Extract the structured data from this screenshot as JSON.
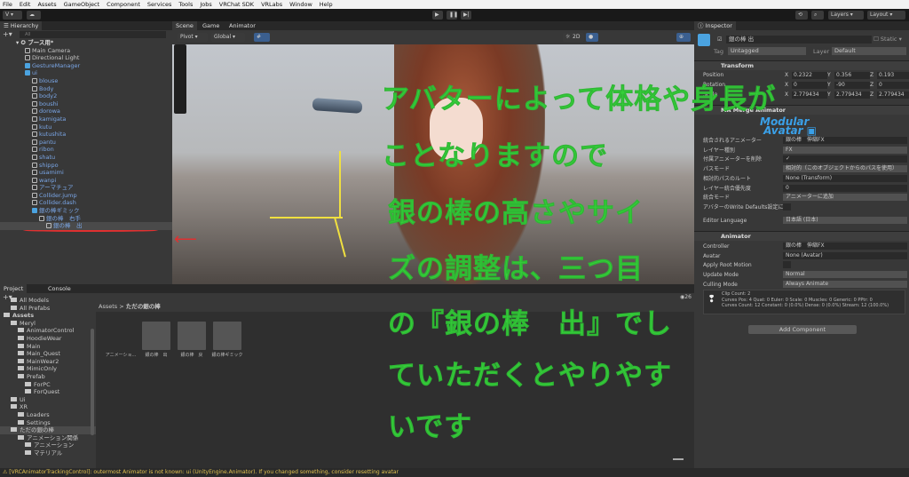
{
  "menu": [
    "File",
    "Edit",
    "Assets",
    "GameObject",
    "Component",
    "Services",
    "Tools",
    "Jobs",
    "VRChat SDK",
    "VRLabs",
    "Window",
    "Help"
  ],
  "toolbar": {
    "account": "V ▾",
    "layers": "Layers",
    "layout": "Layout"
  },
  "hierarchy": {
    "title": "Hierarchy",
    "search_placeholder": "All",
    "scene": "ブース用*",
    "items": [
      {
        "label": "Main Camera",
        "depth": 1,
        "blue": false
      },
      {
        "label": "Directional Light",
        "depth": 1,
        "blue": false
      },
      {
        "label": "GestureManager",
        "depth": 1,
        "blue": true
      },
      {
        "label": "ui",
        "depth": 1,
        "blue": true
      },
      {
        "label": "blouse",
        "depth": 2,
        "blue": true
      },
      {
        "label": "Body",
        "depth": 2,
        "blue": true
      },
      {
        "label": "body2",
        "depth": 2,
        "blue": true
      },
      {
        "label": "boushi",
        "depth": 2,
        "blue": true
      },
      {
        "label": "dorowa",
        "depth": 2,
        "blue": true
      },
      {
        "label": "kamigata",
        "depth": 2,
        "blue": true
      },
      {
        "label": "kutu",
        "depth": 2,
        "blue": true
      },
      {
        "label": "kutushita",
        "depth": 2,
        "blue": true
      },
      {
        "label": "pantu",
        "depth": 2,
        "blue": true
      },
      {
        "label": "ribon",
        "depth": 2,
        "blue": true
      },
      {
        "label": "shatu",
        "depth": 2,
        "blue": true
      },
      {
        "label": "shippo",
        "depth": 2,
        "blue": true
      },
      {
        "label": "usamimi",
        "depth": 2,
        "blue": true
      },
      {
        "label": "wanpi",
        "depth": 2,
        "blue": true
      },
      {
        "label": "アーマチュア",
        "depth": 2,
        "blue": true
      },
      {
        "label": "Collider.jump",
        "depth": 2,
        "blue": true
      },
      {
        "label": "Collider.dash",
        "depth": 2,
        "blue": true
      },
      {
        "label": "銀の棒ギミック",
        "depth": 2,
        "blue": true
      },
      {
        "label": "銀の棒　右手",
        "depth": 3,
        "blue": true
      },
      {
        "label": "銀の棒　出",
        "depth": 4,
        "blue": true
      }
    ]
  },
  "scene": {
    "tabs": [
      "Scene",
      "Game",
      "Animator"
    ],
    "pivot": "Pivot",
    "global": "Global",
    "mode2d": "2D"
  },
  "overlay_text": [
    "アバターによって体格や身長が",
    "ことなりますので",
    "銀の棒の高さやサイ",
    "ズの調整は、三つ目",
    "の『銀の棒　出』でし",
    "ていただくとやりやす",
    "いです"
  ],
  "inspector": {
    "title": "Inspector",
    "object_name": "銀の棒 出",
    "static": "Static",
    "tag_label": "Tag",
    "tag": "Untagged",
    "layer_label": "Layer",
    "layer": "Default",
    "transform": {
      "title": "Transform",
      "rows": [
        {
          "label": "Position",
          "x": "0.2322",
          "y": "0.356",
          "z": "0.193"
        },
        {
          "label": "Rotation",
          "x": "0",
          "y": "-90",
          "z": "0"
        },
        {
          "label": "Scale",
          "x": "2.779434",
          "y": "2.779434",
          "z": "2.779434"
        }
      ]
    },
    "merge": {
      "title": "MA Merge Animator",
      "logo": "Modular Avatar",
      "rows": [
        {
          "label": "統合されるアニメーター",
          "value": "銀の棒　伸縮FX"
        },
        {
          "label": "レイヤー種別",
          "value": "FX"
        },
        {
          "label": "付属アニメーターを削除",
          "value": "✓"
        },
        {
          "label": "パスモード",
          "value": "相対的（このオブジェクトからのパスを使用）"
        },
        {
          "label": "相対的パスのルート",
          "value": "None (Transform)"
        },
        {
          "label": "レイヤー統合優先度",
          "value": "0"
        },
        {
          "label": "統合モード",
          "value": "アニメーターに追加"
        },
        {
          "label": "アバターのWrite Defaults設定に",
          "value": ""
        }
      ],
      "lang_label": "Editor Language",
      "lang": "日本語 (日本)"
    },
    "animator": {
      "title": "Animator",
      "rows": [
        {
          "label": "Controller",
          "value": "銀の棒　伸縮FX"
        },
        {
          "label": "Avatar",
          "value": "None (Avatar)"
        },
        {
          "label": "Apply Root Motion",
          "value": ""
        },
        {
          "label": "Update Mode",
          "value": "Normal"
        },
        {
          "label": "Culling Mode",
          "value": "Always Animate"
        }
      ],
      "info": [
        "Clip Count: 2",
        "Curves Pos: 4 Quat: 0 Euler: 0 Scale: 0 Muscles: 0 Generic: 0 PPtr: 0",
        "Curves Count: 12 Constant: 0 (0.0%) Dense: 0 (0.0%) Stream: 12 (100.0%)"
      ]
    },
    "add_component": "Add Component"
  },
  "project": {
    "tabs": [
      "Project",
      "Console"
    ],
    "badge": "26",
    "breadcrumb": [
      "Assets",
      "ただの銀の棒"
    ],
    "tree": [
      {
        "label": "All Models",
        "depth": 1
      },
      {
        "label": "All Prefabs",
        "depth": 1
      },
      {
        "label": "Assets",
        "depth": 0
      },
      {
        "label": "Meryl",
        "depth": 1
      },
      {
        "label": "AnimatorControl",
        "depth": 2
      },
      {
        "label": "HoodieWear",
        "depth": 2
      },
      {
        "label": "Main",
        "depth": 2
      },
      {
        "label": "Main_Quest",
        "depth": 2
      },
      {
        "label": "MainWear2",
        "depth": 2
      },
      {
        "label": "MimicOnly",
        "depth": 2
      },
      {
        "label": "Prefab",
        "depth": 2
      },
      {
        "label": "ForPC",
        "depth": 3
      },
      {
        "label": "ForQuest",
        "depth": 3
      },
      {
        "label": "Ui",
        "depth": 1
      },
      {
        "label": "XR",
        "depth": 1
      },
      {
        "label": "Loaders",
        "depth": 2
      },
      {
        "label": "Settings",
        "depth": 2
      },
      {
        "label": "ただの銀の棒",
        "depth": 1
      },
      {
        "label": "アニメーション関係",
        "depth": 2
      },
      {
        "label": "アニメーション",
        "depth": 3
      },
      {
        "label": "マテリアル",
        "depth": 3
      }
    ],
    "assets": [
      "アニメーショ...",
      "銀の棒　出",
      "銀の棒　戻",
      "銀の棒ギミック"
    ]
  },
  "status": "[VRCAnimatorTrackingControl]: outermost Animator is not known: ui (UnityEngine.Animator). If you changed something, consider resetting avatar"
}
